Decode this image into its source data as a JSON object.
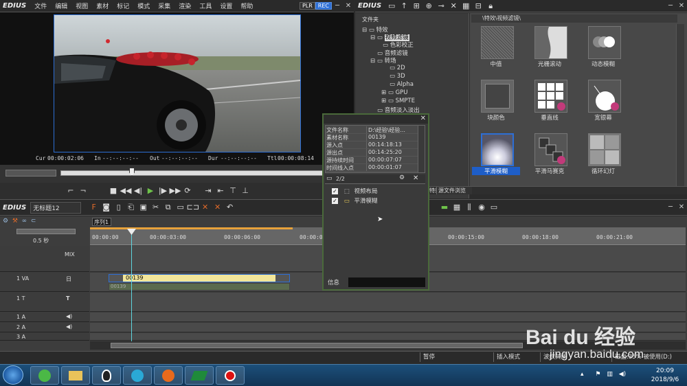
{
  "menubar": {
    "app": "EDIUS",
    "items": [
      "文件",
      "编辑",
      "视图",
      "素材",
      "标记",
      "模式",
      "采集",
      "渲染",
      "工具",
      "设置",
      "帮助"
    ],
    "plr": "PLR",
    "rec": "REC"
  },
  "preview": {
    "timecodes": {
      "cur_label": "Cur",
      "cur": "00:00:02:06",
      "in_label": "In",
      "in": "--:--:--:--",
      "out_label": "Out",
      "out": "--:--:--:--",
      "dur_label": "Dur",
      "dur": "--:--:--:--",
      "ttl_label": "Ttl",
      "ttl": "00:00:08:14"
    }
  },
  "effects_panel": {
    "app": "EDIUS",
    "folder_header": "文件夹",
    "path": "\\特效\\视频滤镜\\",
    "tree": [
      {
        "label": "特效",
        "level": 0
      },
      {
        "label": "视频滤镜",
        "level": 1,
        "selected": true
      },
      {
        "label": "色彩校正",
        "level": 2
      },
      {
        "label": "音频滤镜",
        "level": 1
      },
      {
        "label": "转场",
        "level": 1
      },
      {
        "label": "2D",
        "level": 2
      },
      {
        "label": "3D",
        "level": 2
      },
      {
        "label": "Alpha",
        "level": 2
      },
      {
        "label": "GPU",
        "level": 2
      },
      {
        "label": "SMPTE",
        "level": 2
      },
      {
        "label": "音频淡入淡出",
        "level": 1
      }
    ],
    "effects": [
      {
        "label": "中值"
      },
      {
        "label": "光栅滚动"
      },
      {
        "label": "动态模糊"
      },
      {
        "label": "块颜色"
      },
      {
        "label": "垂直线"
      },
      {
        "label": "宽银幕"
      },
      {
        "label": "平滑模糊",
        "selected": true
      },
      {
        "label": "平滑马赛克"
      },
      {
        "label": "循环幻灯"
      }
    ],
    "tabs": [
      "特效",
      "源文件浏览"
    ]
  },
  "info_panel": {
    "rows": [
      {
        "k": "文件名称",
        "v": "D:\\经验\\经验..."
      },
      {
        "k": "素材名称",
        "v": "00139"
      },
      {
        "k": "源入点",
        "v": "00:14:18:13"
      },
      {
        "k": "源出点",
        "v": "00:14:25:20"
      },
      {
        "k": "源持续时间",
        "v": "00:00:07:07"
      },
      {
        "k": "时间线入点",
        "v": "00:00:01:07"
      }
    ],
    "filter_count": "2/2",
    "filters": [
      {
        "label": "视频布局",
        "checked": true
      },
      {
        "label": "平滑模糊",
        "checked": true
      }
    ],
    "tab": "信息"
  },
  "timeline": {
    "app": "EDIUS",
    "project": "无标题12",
    "sequence_tab": "序列1",
    "zoom": "0.5 秒",
    "ruler": [
      "00:00:00",
      "00:00:03:00",
      "00:00:06:00",
      "00:00:09",
      "00:00:15:00",
      "00:00:18:00",
      "00:00:21:00"
    ],
    "tracks": [
      {
        "name": "",
        "type": "MIX"
      },
      {
        "name": "1 VA",
        "type": "VA"
      },
      {
        "name": "1 T",
        "type": "T"
      },
      {
        "name": "1 A",
        "type": "A"
      },
      {
        "name": "2 A",
        "type": "A"
      },
      {
        "name": "3 A",
        "type": "A"
      }
    ],
    "clip_name": "00139",
    "clip_sub": "00139"
  },
  "statusbar": {
    "pause": "暂停",
    "mode": "插入模式",
    "ripple": "波纹关闭",
    "disk": "磁盘:35% 被使用(D:)"
  },
  "taskbar": {
    "time": "20:09",
    "date": "2018/9/6"
  },
  "watermark": {
    "brand": "Bai du 经验",
    "url": "jingyan.baidu.com"
  },
  "colors": {
    "accent": "#2d6fd6",
    "clip_yellow": "#f2e69a",
    "selected_blue": "#1e5ec8"
  }
}
